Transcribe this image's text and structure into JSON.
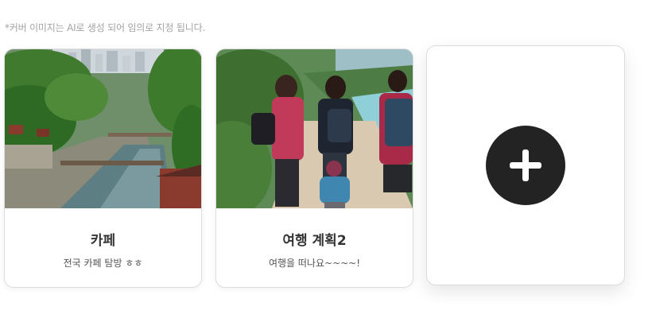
{
  "notice": "*커버 이미지는 AI로 생성 되어 임의로 지정 됩니다.",
  "cards": [
    {
      "title": "카페",
      "description": "전국 카페 탐방 ㅎㅎ",
      "cover_icon": "river-city-image"
    },
    {
      "title": "여행 계획2",
      "description": "여행을 떠나요~~~~!",
      "cover_icon": "family-hiking-image"
    }
  ],
  "add_card": {
    "icon": "plus-icon"
  },
  "colors": {
    "add_button": "#232323",
    "card_border": "#dedede",
    "notice_text": "#a3a3a3"
  }
}
